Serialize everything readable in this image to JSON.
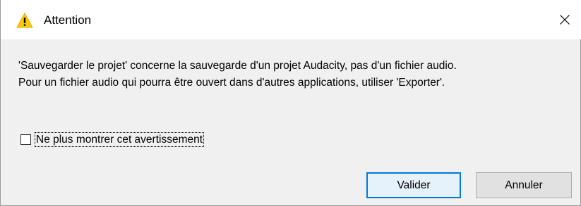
{
  "window": {
    "title": "Attention",
    "title_icon": "warning-icon",
    "close_icon": "close-icon"
  },
  "message": {
    "line1": "'Sauvegarder le projet' concerne la sauvegarde d'un projet Audacity, pas d'un fichier audio.",
    "line2": "Pour un fichier audio qui pourra être ouvert dans d'autres applications, utiliser 'Exporter'."
  },
  "checkbox": {
    "label": "Ne plus montrer cet avertissement",
    "checked": false
  },
  "buttons": {
    "ok_label": "Valider",
    "cancel_label": "Annuler"
  },
  "colors": {
    "warning_yellow": "#ffcc00",
    "primary_border": "#0078d7",
    "primary_fill": "#e5f1fb",
    "dialog_bg": "#f0f0f0"
  }
}
